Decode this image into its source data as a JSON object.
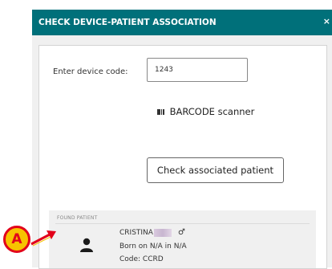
{
  "dialog": {
    "title": "CHECK DEVICE-PATIENT ASSOCIATION",
    "close_glyph": "×"
  },
  "form": {
    "code_label": "Enter device code:",
    "code_value": "1243",
    "barcode_label": "BARCODE scanner",
    "check_button": "Check associated patient"
  },
  "found_patient": {
    "section_label": "FOUND PATIENT",
    "name": "CRISTINA",
    "sex_glyph": "♂",
    "born": "Born on N/A in N/A",
    "code": "Code: CCRD"
  },
  "callout": {
    "letter": "A"
  },
  "colors": {
    "header": "#00707a",
    "callout_fill": "#f7c300",
    "callout_ring": "#e2001a"
  }
}
